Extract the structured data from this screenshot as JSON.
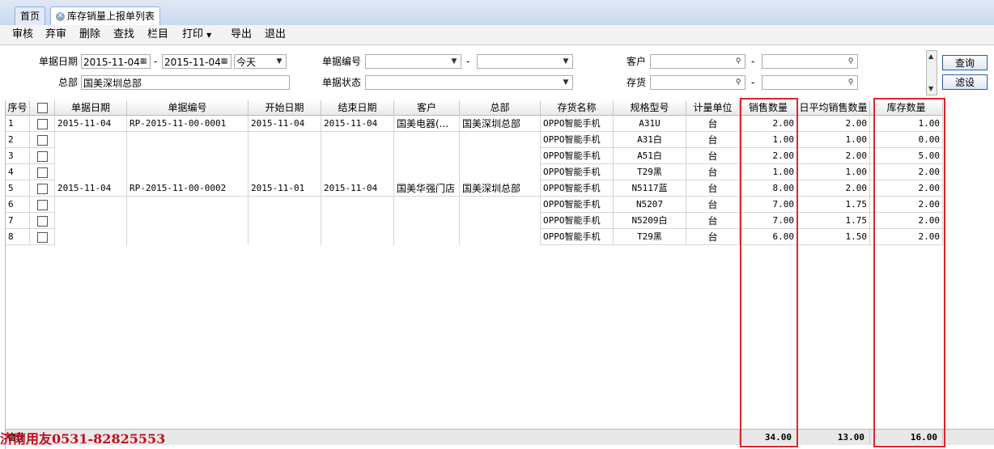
{
  "tabs": [
    {
      "label": "首页"
    },
    {
      "label": "库存销量上报单列表"
    }
  ],
  "toolbar": [
    "审核",
    "弃审",
    "删除",
    "查找",
    "栏目",
    "打印",
    "导出",
    "退出"
  ],
  "filters": {
    "doc_date_label": "单据日期",
    "date_from": "2015-11-04",
    "date_to": "2015-11-04",
    "date_range": "今天",
    "hq_label": "总部",
    "hq_value": "国美深圳总部",
    "doc_no_label": "单据编号",
    "doc_status_label": "单据状态",
    "customer_label": "客户",
    "stock_label": "存货",
    "dash": "-"
  },
  "buttons": {
    "query": "查询",
    "filter": "滤设"
  },
  "columns": [
    "序号",
    "",
    "单据日期",
    "单据编号",
    "开始日期",
    "结束日期",
    "客户",
    "总部",
    "存货名称",
    "规格型号",
    "计量单位",
    "销售数量",
    "日平均销售数量",
    "库存数量"
  ],
  "rows": [
    {
      "no": "1",
      "doc_date": "2015-11-04",
      "doc_no": "RP-2015-11-00-0001",
      "start": "2015-11-04",
      "end": "2015-11-04",
      "customer": "国美电器(...",
      "hq": "国美深圳总部",
      "item": "OPPO智能手机",
      "spec": "A31U",
      "unit": "台",
      "sales": "2.00",
      "avg": "2.00",
      "stock": "1.00"
    },
    {
      "no": "2",
      "doc_date": "",
      "doc_no": "",
      "start": "",
      "end": "",
      "customer": "",
      "hq": "",
      "item": "OPPO智能手机",
      "spec": "A31白",
      "unit": "台",
      "sales": "1.00",
      "avg": "1.00",
      "stock": "0.00"
    },
    {
      "no": "3",
      "doc_date": "",
      "doc_no": "",
      "start": "",
      "end": "",
      "customer": "",
      "hq": "",
      "item": "OPPO智能手机",
      "spec": "A51白",
      "unit": "台",
      "sales": "2.00",
      "avg": "2.00",
      "stock": "5.00"
    },
    {
      "no": "4",
      "doc_date": "",
      "doc_no": "",
      "start": "",
      "end": "",
      "customer": "",
      "hq": "",
      "item": "OPPO智能手机",
      "spec": "T29黑",
      "unit": "台",
      "sales": "1.00",
      "avg": "1.00",
      "stock": "2.00"
    },
    {
      "no": "5",
      "doc_date": "2015-11-04",
      "doc_no": "RP-2015-11-00-0002",
      "start": "2015-11-01",
      "end": "2015-11-04",
      "customer": "国美华强门店",
      "hq": "国美深圳总部",
      "item": "OPPO智能手机",
      "spec": "N5117蓝",
      "unit": "台",
      "sales": "8.00",
      "avg": "2.00",
      "stock": "2.00"
    },
    {
      "no": "6",
      "doc_date": "",
      "doc_no": "",
      "start": "",
      "end": "",
      "customer": "",
      "hq": "",
      "item": "OPPO智能手机",
      "spec": "N5207",
      "unit": "台",
      "sales": "7.00",
      "avg": "1.75",
      "stock": "2.00"
    },
    {
      "no": "7",
      "doc_date": "",
      "doc_no": "",
      "start": "",
      "end": "",
      "customer": "",
      "hq": "",
      "item": "OPPO智能手机",
      "spec": "N5209白",
      "unit": "台",
      "sales": "7.00",
      "avg": "1.75",
      "stock": "2.00"
    },
    {
      "no": "8",
      "doc_date": "",
      "doc_no": "",
      "start": "",
      "end": "",
      "customer": "",
      "hq": "",
      "item": "OPPO智能手机",
      "spec": "T29黑",
      "unit": "台",
      "sales": "6.00",
      "avg": "1.50",
      "stock": "2.00"
    }
  ],
  "totals": {
    "label": "合计",
    "sales": "34.00",
    "avg": "13.00",
    "stock": "16.00"
  },
  "watermark": "济南用友0531-82825553",
  "colors": {
    "highlight": "#e0242c",
    "tab_border": "#8db2e3",
    "watermark": "#c0111b"
  }
}
